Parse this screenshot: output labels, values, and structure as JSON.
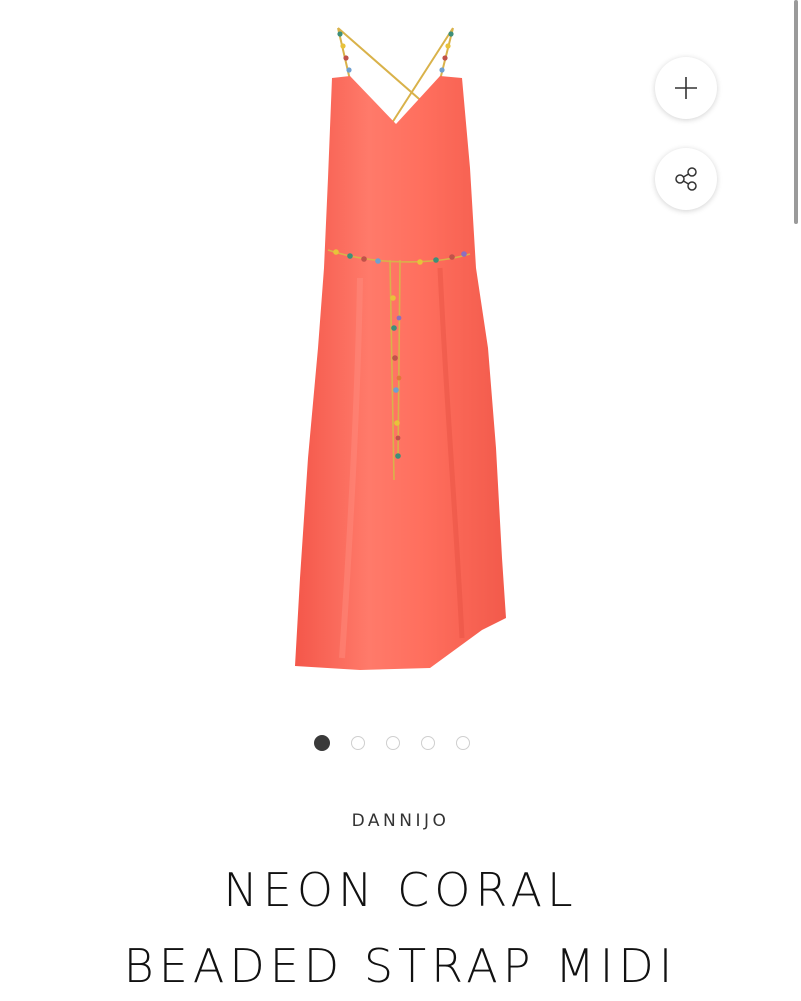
{
  "product": {
    "brand": "DANNIJO",
    "title_line1": "NEON CORAL",
    "title_line2": "BEADED STRAP MIDI",
    "image_alt": "Neon coral beaded strap midi dress",
    "image_icon": "dress-image"
  },
  "actions": {
    "add_icon": "plus-icon",
    "share_icon": "share-icon"
  },
  "carousel": {
    "total_slides": 5,
    "active_index": 0
  },
  "colors": {
    "dress": "#FF6B5A",
    "active_dot": "#3A3A3A",
    "text": "#111111"
  }
}
